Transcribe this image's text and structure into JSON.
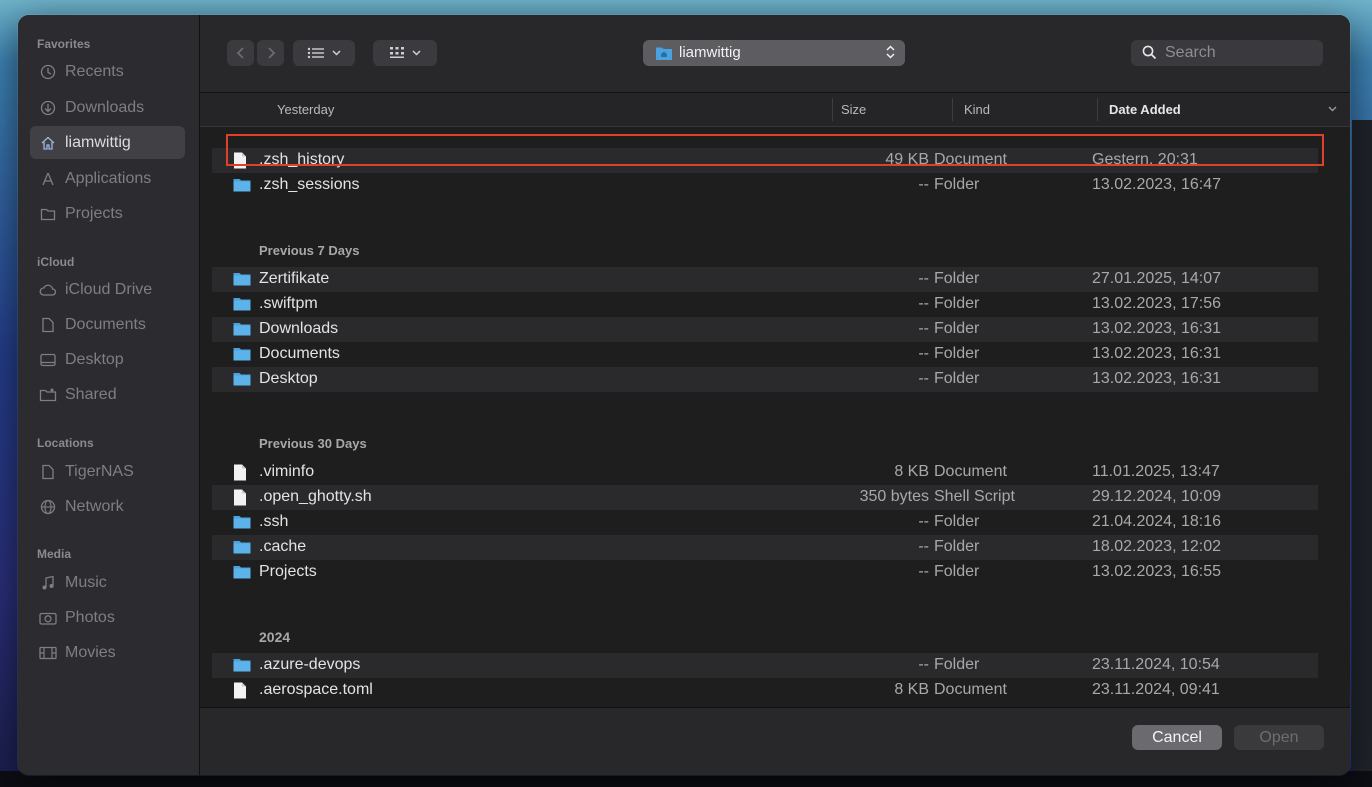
{
  "sidebar": {
    "favorites_title": "Favorites",
    "favorites": [
      {
        "label": "Recents",
        "icon": "clock-icon"
      },
      {
        "label": "Downloads",
        "icon": "download-icon"
      },
      {
        "label": "liamwittig",
        "icon": "home-icon",
        "selected": true
      },
      {
        "label": "Applications",
        "icon": "applications-icon"
      },
      {
        "label": "Projects",
        "icon": "folder-icon"
      }
    ],
    "icloud_title": "iCloud",
    "icloud": [
      {
        "label": "iCloud Drive",
        "icon": "cloud-icon"
      },
      {
        "label": "Documents",
        "icon": "document-icon"
      },
      {
        "label": "Desktop",
        "icon": "desktop-icon"
      },
      {
        "label": "Shared",
        "icon": "shared-folder-icon"
      }
    ],
    "locations_title": "Locations",
    "locations": [
      {
        "label": "TigerNAS",
        "icon": "server-icon"
      },
      {
        "label": "Network",
        "icon": "globe-icon"
      }
    ],
    "media_title": "Media",
    "media": [
      {
        "label": "Music",
        "icon": "music-icon"
      },
      {
        "label": "Photos",
        "icon": "camera-icon"
      },
      {
        "label": "Movies",
        "icon": "film-icon"
      }
    ]
  },
  "toolbar": {
    "location": "liamwittig",
    "search_placeholder": "Search"
  },
  "columns": {
    "name": "Yesterday",
    "size": "Size",
    "kind": "Kind",
    "date": "Date Added"
  },
  "groups": {
    "previous7": "Previous 7 Days",
    "previous30": "Previous 30 Days",
    "year2024": "2024"
  },
  "rows": [
    {
      "name": ".zsh_history",
      "size": "49 KB",
      "kind": "Document",
      "date": "Gestern, 20:31",
      "type": "doc"
    },
    {
      "name": ".zsh_sessions",
      "size": "--",
      "kind": "Folder",
      "date": "13.02.2023, 16:47",
      "type": "folder"
    },
    {
      "name": "Zertifikate",
      "size": "--",
      "kind": "Folder",
      "date": "27.01.2025, 14:07",
      "type": "folder"
    },
    {
      "name": ".swiftpm",
      "size": "--",
      "kind": "Folder",
      "date": "13.02.2023, 17:56",
      "type": "folder"
    },
    {
      "name": "Downloads",
      "size": "--",
      "kind": "Folder",
      "date": "13.02.2023, 16:31",
      "type": "folder"
    },
    {
      "name": "Documents",
      "size": "--",
      "kind": "Folder",
      "date": "13.02.2023, 16:31",
      "type": "folder"
    },
    {
      "name": "Desktop",
      "size": "--",
      "kind": "Folder",
      "date": "13.02.2023, 16:31",
      "type": "folder"
    },
    {
      "name": ".viminfo",
      "size": "8 KB",
      "kind": "Document",
      "date": "11.01.2025, 13:47",
      "type": "doc"
    },
    {
      "name": ".open_ghotty.sh",
      "size": "350 bytes",
      "kind": "Shell Script",
      "date": "29.12.2024, 10:09",
      "type": "doc"
    },
    {
      "name": ".ssh",
      "size": "--",
      "kind": "Folder",
      "date": "21.04.2024, 18:16",
      "type": "folder"
    },
    {
      "name": ".cache",
      "size": "--",
      "kind": "Folder",
      "date": "18.02.2023, 12:02",
      "type": "folder"
    },
    {
      "name": "Projects",
      "size": "--",
      "kind": "Folder",
      "date": "13.02.2023, 16:55",
      "type": "folder"
    },
    {
      "name": ".azure-devops",
      "size": "--",
      "kind": "Folder",
      "date": "23.11.2024, 10:54",
      "type": "folder"
    },
    {
      "name": ".aerospace.toml",
      "size": "8 KB",
      "kind": "Document",
      "date": "23.11.2024, 09:41",
      "type": "doc"
    }
  ],
  "footer": {
    "cancel": "Cancel",
    "open": "Open"
  },
  "colors": {
    "highlight": "#e0402a",
    "folder": "#4aa3df",
    "selected_sidebar": "#404045"
  }
}
